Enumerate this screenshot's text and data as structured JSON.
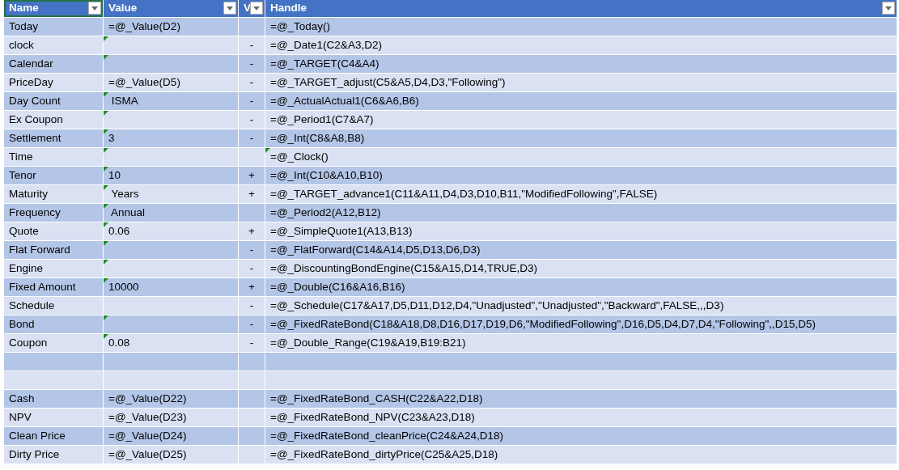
{
  "columns": [
    {
      "label": "Name",
      "selected": true
    },
    {
      "label": "Value",
      "selected": false
    },
    {
      "label": "V",
      "selected": false
    },
    {
      "label": "Handle",
      "selected": false
    }
  ],
  "rows": [
    {
      "kind": "data",
      "name": "Today",
      "value": "=@_Value(D2)",
      "handle": "=@_Today()"
    },
    {
      "kind": "data",
      "name": "clock",
      "value_flag": true,
      "sign": "-",
      "handle": "=@_Date1(C2&A3,D2)"
    },
    {
      "kind": "data",
      "name": "Calendar",
      "value_flag": true,
      "sign": "-",
      "handle": "=@_TARGET(C4&A4)"
    },
    {
      "kind": "data",
      "name": "PriceDay",
      "value": "=@_Value(D5)",
      "sign": "-",
      "handle": "=@_TARGET_adjust(C5&A5,D4,D3,\"Following\")"
    },
    {
      "kind": "data",
      "name": "Day Count",
      "value": " ISMA",
      "value_flag": true,
      "sign": "-",
      "handle": "=@_ActualActual1(C6&A6,B6)"
    },
    {
      "kind": "data",
      "name": "Ex Coupon",
      "value_flag": true,
      "sign": "-",
      "handle": "=@_Period1(C7&A7)"
    },
    {
      "kind": "data",
      "name": "Settlement",
      "value": "3",
      "value_flag": true,
      "sign": "-",
      "handle": "=@_Int(C8&A8,B8)"
    },
    {
      "kind": "data",
      "name": "Time",
      "value_flag": true,
      "handle": "=@_Clock()",
      "handle_flag": true
    },
    {
      "kind": "data",
      "name": "Tenor",
      "value": "10",
      "value_flag": true,
      "sign": "+",
      "handle": "=@_Int(C10&A10,B10)"
    },
    {
      "kind": "data",
      "name": "Maturity",
      "value": " Years",
      "value_flag": true,
      "sign": "+",
      "handle": "=@_TARGET_advance1(C11&A11,D4,D3,D10,B11,\"ModifiedFollowing\",FALSE)"
    },
    {
      "kind": "data",
      "name": "Frequency",
      "value": " Annual",
      "value_flag": true,
      "handle": "=@_Period2(A12,B12)"
    },
    {
      "kind": "data",
      "name": "Quote",
      "value": "0.06",
      "value_flag": true,
      "sign": "+",
      "handle": "=@_SimpleQuote1(A13,B13)"
    },
    {
      "kind": "data",
      "name": "Flat Forward",
      "value_flag": true,
      "sign": "-",
      "handle": "=@_FlatForward(C14&A14,D5,D13,D6,D3)"
    },
    {
      "kind": "data",
      "name": "Engine",
      "value_flag": true,
      "sign": "-",
      "handle": "=@_DiscountingBondEngine(C15&A15,D14,TRUE,D3)"
    },
    {
      "kind": "data",
      "name": "Fixed Amount",
      "value": "10000",
      "value_flag": true,
      "sign": "+",
      "handle": "=@_Double(C16&A16,B16)"
    },
    {
      "kind": "data",
      "name": "Schedule",
      "sign": "-",
      "handle": "=@_Schedule(C17&A17,D5,D11,D12,D4,\"Unadjusted\",\"Unadjusted\",\"Backward\",FALSE,,,D3)"
    },
    {
      "kind": "data",
      "name": "Bond",
      "value_flag": true,
      "sign": "-",
      "handle": "=@_FixedRateBond(C18&A18,D8,D16,D17,D19,D6,\"ModifiedFollowing\",D16,D5,D4,D7,D4,\"Following\",,D15,D5)"
    },
    {
      "kind": "data",
      "name": "Coupon",
      "value": "0.08",
      "value_flag": true,
      "sign": "-",
      "handle": "=@_Double_Range(C19&A19,B19:B21)"
    },
    {
      "kind": "blank"
    },
    {
      "kind": "blank"
    },
    {
      "kind": "data",
      "name": "Cash",
      "value": "=@_Value(D22)",
      "handle": "=@_FixedRateBond_CASH(C22&A22,D18)"
    },
    {
      "kind": "data",
      "name": "NPV",
      "value": "=@_Value(D23)",
      "handle": "=@_FixedRateBond_NPV(C23&A23,D18)"
    },
    {
      "kind": "data",
      "name": "Clean Price",
      "value": "=@_Value(D24)",
      "handle": "=@_FixedRateBond_cleanPrice(C24&A24,D18)"
    },
    {
      "kind": "data",
      "name": "Dirty Price",
      "value": "=@_Value(D25)",
      "handle": "=@_FixedRateBond_dirtyPrice(C25&A25,D18)"
    }
  ]
}
